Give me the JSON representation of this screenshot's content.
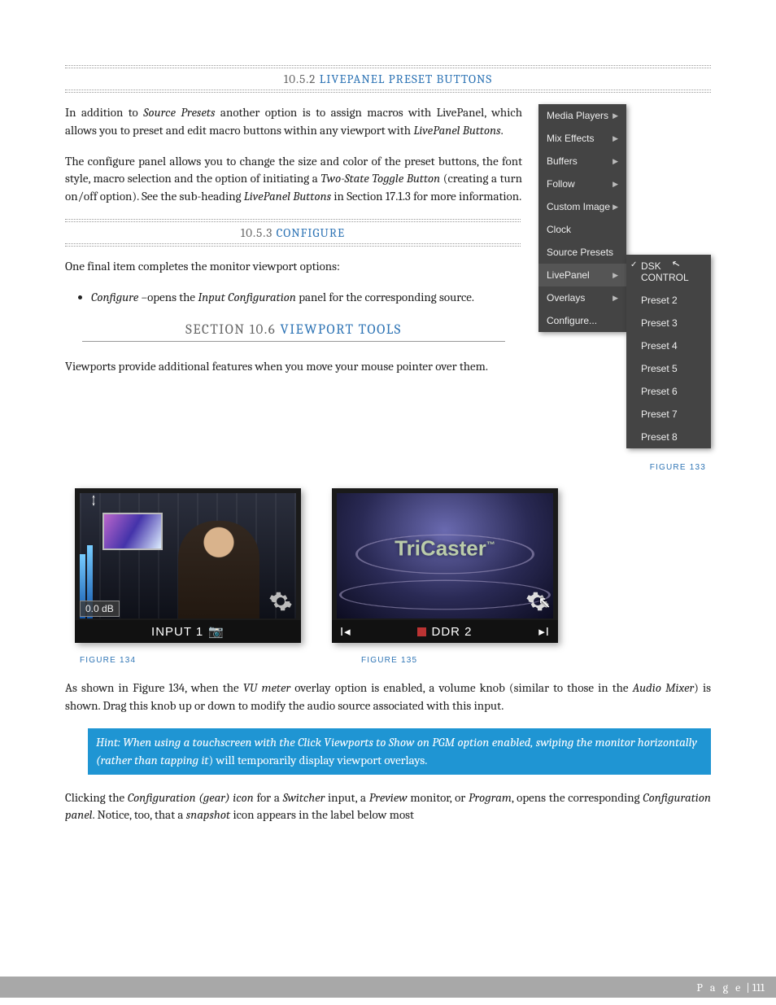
{
  "headings": {
    "h1_num": "10.5.2",
    "h1_title": "LIVEPANEL PRESET BUTTONS",
    "h2_num": "10.5.3",
    "h2_title": "CONFIGURE",
    "h3_pre": "SECTION 10.6",
    "h3_title": "VIEWPORT TOOLS"
  },
  "paras": {
    "p1a": "In addition to ",
    "p1b": "Source Presets",
    "p1c": " another option is to assign macros with LivePanel, which allows you to preset and edit macro buttons within any viewport with ",
    "p1d": "LivePanel Buttons",
    "p1e": ".",
    "p2a": "The configure panel allows you to change the size and color of the preset buttons, the font style, macro selection and the option of initiating a ",
    "p2b": "Two-State Toggle Button",
    "p2c": " (creating a turn on/off option).  See the sub-heading ",
    "p2d": "LivePanel Buttons",
    "p2e": " in Section 17.1.3 for more information.",
    "p3": "One final item completes the monitor viewport options:",
    "li_a": "Configure –",
    "li_b": "opens the ",
    "li_c": "Input Configuration",
    "li_d": " panel for the corresponding source.",
    "p4": "Viewports provide additional features when you move your mouse pointer over them.",
    "p5a": "As shown in Figure 134, when the ",
    "p5b": "VU meter",
    "p5c": " overlay option is enabled, a volume knob (similar to those in the ",
    "p5d": "Audio Mixer",
    "p5e": ") is shown.  Drag this knob up or down to modify the audio source associated with this input.",
    "hint_a": "Hint: When using a touchscreen with the Click Viewports to Show on PGM option enabled, swiping the monitor horizontally (rather than tapping it",
    "hint_b": ") will temporarily display viewport overlays.",
    "p6a": "Clicking the ",
    "p6b": "Configuration (gear) icon",
    "p6c": " for a ",
    "p6d": "Switcher",
    "p6e": " input, a ",
    "p6f": "Preview",
    "p6g": " monitor, or ",
    "p6h": "Program",
    "p6i": ", opens the corresponding ",
    "p6j": "Configuration panel",
    "p6k": ".  Notice, too, that a ",
    "p6l": "snapshot",
    "p6m": " icon appears in the label below most"
  },
  "menu": {
    "items": [
      "Media Players",
      "Mix Effects",
      "Buffers",
      "Follow",
      "Custom Image",
      "Clock",
      "Source Presets",
      "LivePanel",
      "Overlays",
      "Configure..."
    ],
    "arrows": [
      true,
      true,
      true,
      true,
      true,
      false,
      false,
      true,
      true,
      false
    ],
    "highlight": "LivePanel",
    "sub": [
      "DSK CONTROL",
      "Preset 2",
      "Preset 3",
      "Preset 4",
      "Preset 5",
      "Preset 6",
      "Preset 7",
      "Preset 8"
    ],
    "checked": "DSK CONTROL"
  },
  "figs": {
    "f133": "FIGURE 133",
    "f134": "FIGURE 134",
    "f135": "FIGURE 135"
  },
  "shot1": {
    "db": "0.0 dB",
    "label": "INPUT 1"
  },
  "shot2": {
    "label": "DDR 2",
    "logo": "TriCaster",
    "tm": "™"
  },
  "footer": {
    "page_word": "P a g e",
    "sep": " | ",
    "num": "111"
  }
}
